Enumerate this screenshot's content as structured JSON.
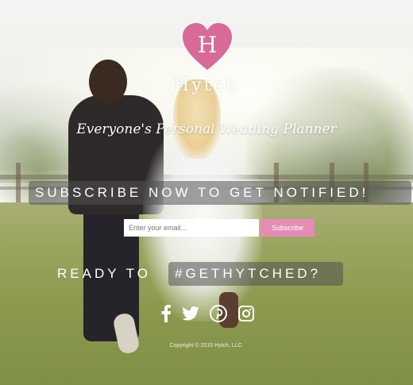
{
  "brand": {
    "logo_letter": "H",
    "name": "Hytch",
    "tagline": "Everyone's Personal Wedding Planner",
    "accent_color": "#d86a98"
  },
  "banner": {
    "subscribe_text": "SUBSCRIBE NOW TO GET NOTIFIED!"
  },
  "form": {
    "email_placeholder": "Enter your email...",
    "subscribe_button": "Subscribe",
    "button_color": "#e58cb5"
  },
  "cta": {
    "ready_text": "READY TO",
    "hashtag_text": "#GETHYTCHED?"
  },
  "social": {
    "icons": [
      "facebook-icon",
      "twitter-icon",
      "pinterest-icon",
      "instagram-icon"
    ]
  },
  "footer": {
    "copyright": "Copyright © 2015 Hytch, LLC."
  }
}
